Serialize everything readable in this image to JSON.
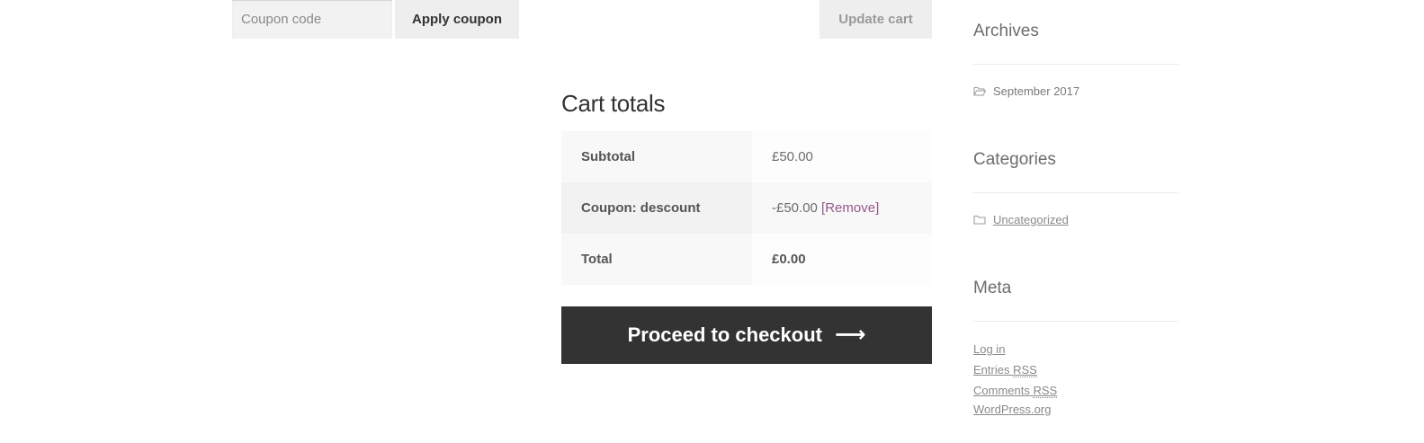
{
  "cart": {
    "coupon_placeholder": "Coupon code",
    "apply_coupon_label": "Apply coupon",
    "update_cart_label": "Update cart"
  },
  "cart_totals": {
    "title": "Cart totals",
    "rows": [
      {
        "label": "Subtotal",
        "value": "£50.00"
      },
      {
        "label": "Coupon: descount",
        "value": "-£50.00",
        "link": "[Remove]"
      },
      {
        "label": "Total",
        "value": "£0.00"
      }
    ],
    "checkout_label": "Proceed to checkout",
    "checkout_arrow": "⟶"
  },
  "sidebar": {
    "archives": {
      "title": "Archives",
      "item": "September 2017"
    },
    "categories": {
      "title": "Categories",
      "item": "Uncategorized"
    },
    "meta": {
      "title": "Meta",
      "log_in": "Log in",
      "entries_prefix": "Entries",
      "comments_prefix": "Comments",
      "rss": "RSS",
      "wordpress": "WordPress.org"
    }
  },
  "colors": {
    "accent_link": "#96588a",
    "checkout_bg": "#333333"
  },
  "icons": [
    "folder-open-icon",
    "folder-icon",
    "arrow-right-icon"
  ]
}
